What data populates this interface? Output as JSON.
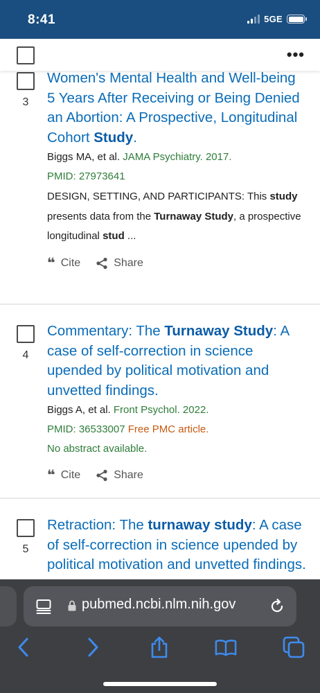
{
  "status_bar": {
    "time": "8:41",
    "network": "5GE"
  },
  "header": {
    "more_label": "•••"
  },
  "results": [
    {
      "number": "3",
      "title_parts": [
        {
          "text": "Women's Mental Health and Well-being 5 Years After Receiving or Being Denied an Abortion: A Prospective, Longitudinal Cohort ",
          "bold": false
        },
        {
          "text": "Study",
          "bold": true
        },
        {
          "text": ".",
          "bold": false
        }
      ],
      "authors": "Biggs MA, et al. ",
      "journal": "JAMA Psychiatry. 2017.",
      "pmid": "PMID: 27973641",
      "free_pmc": "",
      "snippet_parts": [
        {
          "text": "DESIGN, SETTING, AND PARTICIPANTS: This ",
          "bold": false
        },
        {
          "text": "study",
          "bold": true
        },
        {
          "text": " presents data from the ",
          "bold": false
        },
        {
          "text": "Turnaway Study",
          "bold": true
        },
        {
          "text": ", a prospective longitudinal ",
          "bold": false
        },
        {
          "text": "stud",
          "bold": true
        },
        {
          "text": " ...",
          "bold": false
        }
      ],
      "no_abstract": "",
      "cite_label": "Cite",
      "share_label": "Share"
    },
    {
      "number": "4",
      "title_parts": [
        {
          "text": "Commentary: The ",
          "bold": false
        },
        {
          "text": "Turnaway Study",
          "bold": true
        },
        {
          "text": ": A case of self-correction in science upended by political motivation and unvetted findings.",
          "bold": false
        }
      ],
      "authors": "Biggs A, et al. ",
      "journal": "Front Psychol. 2022.",
      "pmid": "PMID: 36533007 ",
      "free_pmc": "Free PMC article.",
      "snippet_parts": [],
      "no_abstract": "No abstract available.",
      "cite_label": "Cite",
      "share_label": "Share"
    },
    {
      "number": "5",
      "title_parts": [
        {
          "text": "Retraction: The ",
          "bold": false
        },
        {
          "text": "turnaway study",
          "bold": true
        },
        {
          "text": ": A case of self-correction in science upended by political motivation and unvetted findings.",
          "bold": false
        }
      ],
      "authors": "",
      "journal": "",
      "pmid": "",
      "free_pmc": "",
      "snippet_parts": [],
      "no_abstract": "",
      "cite_label": "",
      "share_label": ""
    }
  ],
  "browser": {
    "url_host": "pubmed.ncbi.nlm.nih.gov",
    "toolbar_icons": [
      "back-icon",
      "forward-icon",
      "share-icon",
      "bookmarks-icon",
      "tabs-icon"
    ],
    "accent_color": "#3d8cf0"
  },
  "colors": {
    "status_bar": "#1a4e80",
    "title_link": "#0a6cb8",
    "journal_green": "#2f7d3a",
    "free_pmc_orange": "#c75b12",
    "chrome_bg": "#3e3f43"
  }
}
